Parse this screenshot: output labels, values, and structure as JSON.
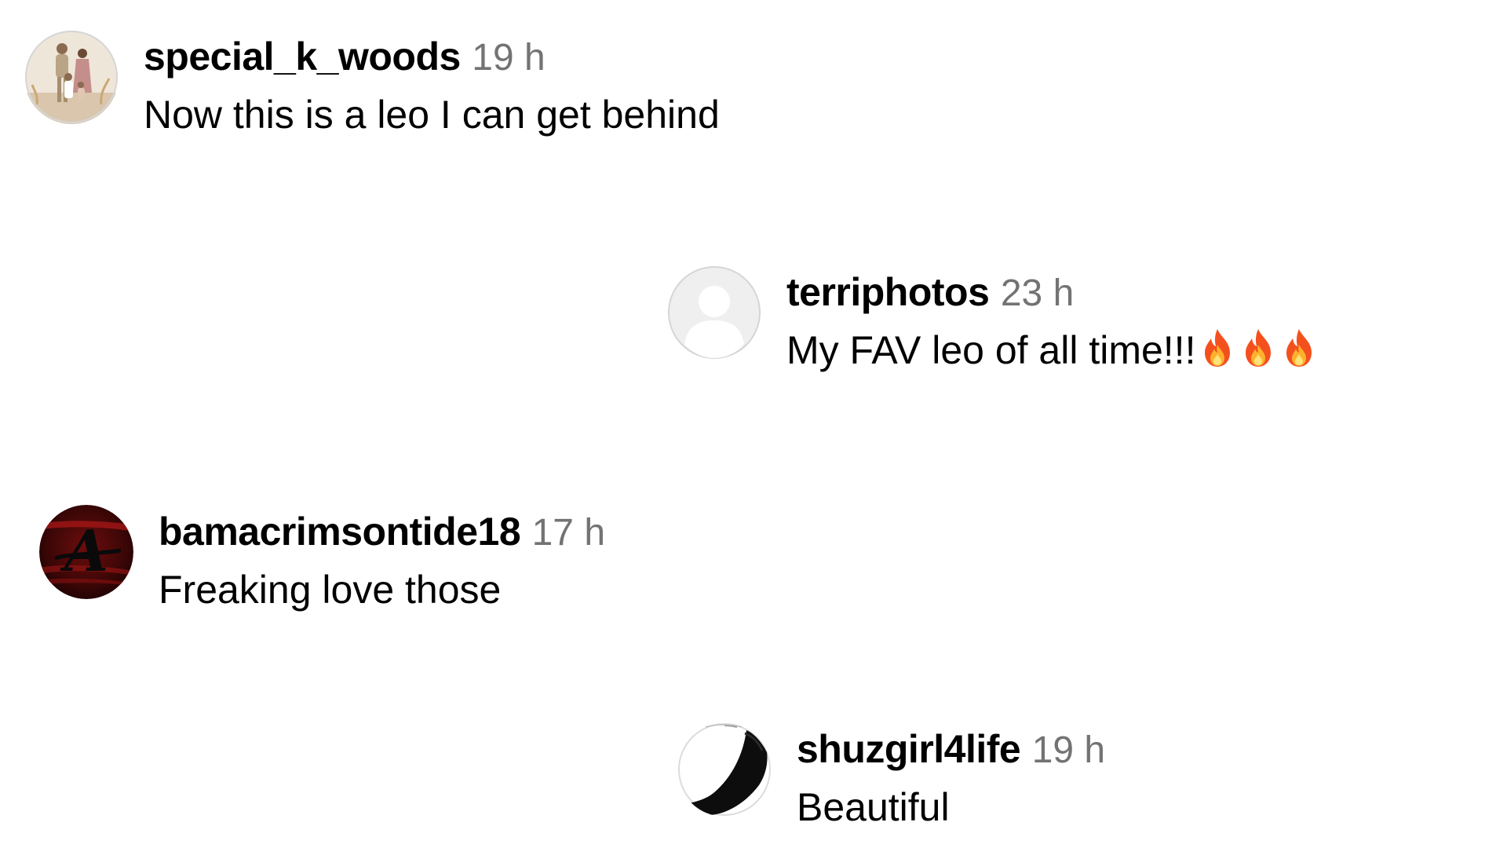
{
  "comments": [
    {
      "username": "special_k_woods",
      "time": "19 h",
      "text": "Now this is a leo I can get behind",
      "avatar": "family-photo"
    },
    {
      "username": "terriphotos",
      "time": "23 h",
      "text": "My FAV leo of all time!!!",
      "emoji": [
        "fire-emoji",
        "fire-emoji",
        "fire-emoji"
      ],
      "avatar": "default-profile"
    },
    {
      "username": "bamacrimsontide18",
      "time": "17 h",
      "text": "Freaking love those",
      "avatar": "crimson-script-a"
    },
    {
      "username": "shuzgirl4life",
      "time": "19 h",
      "text": "Beautiful",
      "avatar": "black-heel-shoe"
    }
  ],
  "colors": {
    "username": "#000000",
    "timestamp": "#737373",
    "background": "#ffffff",
    "crimson": "#9e1b1b"
  }
}
